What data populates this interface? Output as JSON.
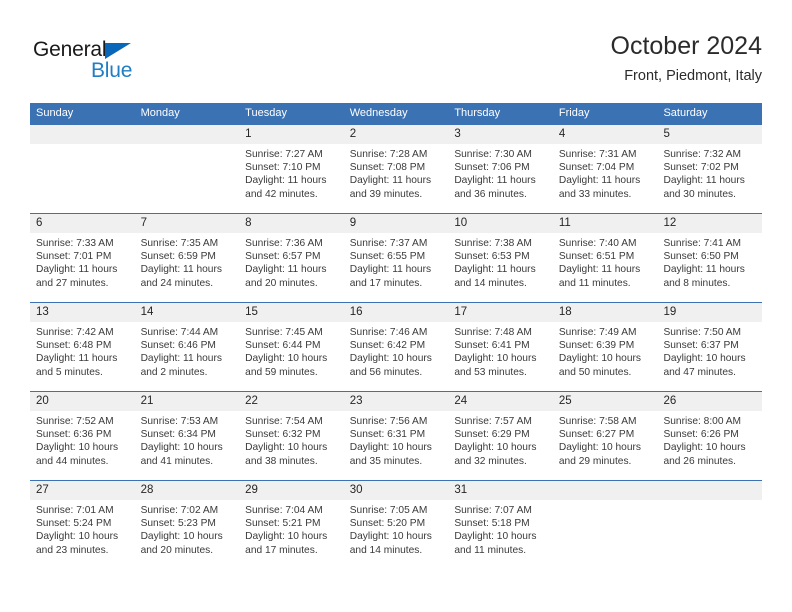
{
  "brand": {
    "name_top": "General",
    "name_bottom": "Blue",
    "color_dark": "#1a1a1a",
    "color_blue": "#1f7ec4",
    "triangle_color": "#0a66b8"
  },
  "header": {
    "title": "October 2024",
    "subtitle": "Front, Piedmont, Italy"
  },
  "theme": {
    "header_bar_color": "#3b72b4",
    "day_band_color": "#f0f0f0",
    "text_color": "#3a3a3a"
  },
  "weekdays": [
    "Sunday",
    "Monday",
    "Tuesday",
    "Wednesday",
    "Thursday",
    "Friday",
    "Saturday"
  ],
  "labels": {
    "sunrise_prefix": "Sunrise:",
    "sunset_prefix": "Sunset:",
    "daylight_prefix": "Daylight:"
  },
  "weeks": [
    [
      {
        "day": "",
        "sunrise": "",
        "sunset": "",
        "daylight_line1": "",
        "daylight_line2": ""
      },
      {
        "day": "",
        "sunrise": "",
        "sunset": "",
        "daylight_line1": "",
        "daylight_line2": ""
      },
      {
        "day": "1",
        "sunrise": "Sunrise: 7:27 AM",
        "sunset": "Sunset: 7:10 PM",
        "daylight_line1": "Daylight: 11 hours",
        "daylight_line2": "and 42 minutes."
      },
      {
        "day": "2",
        "sunrise": "Sunrise: 7:28 AM",
        "sunset": "Sunset: 7:08 PM",
        "daylight_line1": "Daylight: 11 hours",
        "daylight_line2": "and 39 minutes."
      },
      {
        "day": "3",
        "sunrise": "Sunrise: 7:30 AM",
        "sunset": "Sunset: 7:06 PM",
        "daylight_line1": "Daylight: 11 hours",
        "daylight_line2": "and 36 minutes."
      },
      {
        "day": "4",
        "sunrise": "Sunrise: 7:31 AM",
        "sunset": "Sunset: 7:04 PM",
        "daylight_line1": "Daylight: 11 hours",
        "daylight_line2": "and 33 minutes."
      },
      {
        "day": "5",
        "sunrise": "Sunrise: 7:32 AM",
        "sunset": "Sunset: 7:02 PM",
        "daylight_line1": "Daylight: 11 hours",
        "daylight_line2": "and 30 minutes."
      }
    ],
    [
      {
        "day": "6",
        "sunrise": "Sunrise: 7:33 AM",
        "sunset": "Sunset: 7:01 PM",
        "daylight_line1": "Daylight: 11 hours",
        "daylight_line2": "and 27 minutes."
      },
      {
        "day": "7",
        "sunrise": "Sunrise: 7:35 AM",
        "sunset": "Sunset: 6:59 PM",
        "daylight_line1": "Daylight: 11 hours",
        "daylight_line2": "and 24 minutes."
      },
      {
        "day": "8",
        "sunrise": "Sunrise: 7:36 AM",
        "sunset": "Sunset: 6:57 PM",
        "daylight_line1": "Daylight: 11 hours",
        "daylight_line2": "and 20 minutes."
      },
      {
        "day": "9",
        "sunrise": "Sunrise: 7:37 AM",
        "sunset": "Sunset: 6:55 PM",
        "daylight_line1": "Daylight: 11 hours",
        "daylight_line2": "and 17 minutes."
      },
      {
        "day": "10",
        "sunrise": "Sunrise: 7:38 AM",
        "sunset": "Sunset: 6:53 PM",
        "daylight_line1": "Daylight: 11 hours",
        "daylight_line2": "and 14 minutes."
      },
      {
        "day": "11",
        "sunrise": "Sunrise: 7:40 AM",
        "sunset": "Sunset: 6:51 PM",
        "daylight_line1": "Daylight: 11 hours",
        "daylight_line2": "and 11 minutes."
      },
      {
        "day": "12",
        "sunrise": "Sunrise: 7:41 AM",
        "sunset": "Sunset: 6:50 PM",
        "daylight_line1": "Daylight: 11 hours",
        "daylight_line2": "and 8 minutes."
      }
    ],
    [
      {
        "day": "13",
        "sunrise": "Sunrise: 7:42 AM",
        "sunset": "Sunset: 6:48 PM",
        "daylight_line1": "Daylight: 11 hours",
        "daylight_line2": "and 5 minutes."
      },
      {
        "day": "14",
        "sunrise": "Sunrise: 7:44 AM",
        "sunset": "Sunset: 6:46 PM",
        "daylight_line1": "Daylight: 11 hours",
        "daylight_line2": "and 2 minutes."
      },
      {
        "day": "15",
        "sunrise": "Sunrise: 7:45 AM",
        "sunset": "Sunset: 6:44 PM",
        "daylight_line1": "Daylight: 10 hours",
        "daylight_line2": "and 59 minutes."
      },
      {
        "day": "16",
        "sunrise": "Sunrise: 7:46 AM",
        "sunset": "Sunset: 6:42 PM",
        "daylight_line1": "Daylight: 10 hours",
        "daylight_line2": "and 56 minutes."
      },
      {
        "day": "17",
        "sunrise": "Sunrise: 7:48 AM",
        "sunset": "Sunset: 6:41 PM",
        "daylight_line1": "Daylight: 10 hours",
        "daylight_line2": "and 53 minutes."
      },
      {
        "day": "18",
        "sunrise": "Sunrise: 7:49 AM",
        "sunset": "Sunset: 6:39 PM",
        "daylight_line1": "Daylight: 10 hours",
        "daylight_line2": "and 50 minutes."
      },
      {
        "day": "19",
        "sunrise": "Sunrise: 7:50 AM",
        "sunset": "Sunset: 6:37 PM",
        "daylight_line1": "Daylight: 10 hours",
        "daylight_line2": "and 47 minutes."
      }
    ],
    [
      {
        "day": "20",
        "sunrise": "Sunrise: 7:52 AM",
        "sunset": "Sunset: 6:36 PM",
        "daylight_line1": "Daylight: 10 hours",
        "daylight_line2": "and 44 minutes."
      },
      {
        "day": "21",
        "sunrise": "Sunrise: 7:53 AM",
        "sunset": "Sunset: 6:34 PM",
        "daylight_line1": "Daylight: 10 hours",
        "daylight_line2": "and 41 minutes."
      },
      {
        "day": "22",
        "sunrise": "Sunrise: 7:54 AM",
        "sunset": "Sunset: 6:32 PM",
        "daylight_line1": "Daylight: 10 hours",
        "daylight_line2": "and 38 minutes."
      },
      {
        "day": "23",
        "sunrise": "Sunrise: 7:56 AM",
        "sunset": "Sunset: 6:31 PM",
        "daylight_line1": "Daylight: 10 hours",
        "daylight_line2": "and 35 minutes."
      },
      {
        "day": "24",
        "sunrise": "Sunrise: 7:57 AM",
        "sunset": "Sunset: 6:29 PM",
        "daylight_line1": "Daylight: 10 hours",
        "daylight_line2": "and 32 minutes."
      },
      {
        "day": "25",
        "sunrise": "Sunrise: 7:58 AM",
        "sunset": "Sunset: 6:27 PM",
        "daylight_line1": "Daylight: 10 hours",
        "daylight_line2": "and 29 minutes."
      },
      {
        "day": "26",
        "sunrise": "Sunrise: 8:00 AM",
        "sunset": "Sunset: 6:26 PM",
        "daylight_line1": "Daylight: 10 hours",
        "daylight_line2": "and 26 minutes."
      }
    ],
    [
      {
        "day": "27",
        "sunrise": "Sunrise: 7:01 AM",
        "sunset": "Sunset: 5:24 PM",
        "daylight_line1": "Daylight: 10 hours",
        "daylight_line2": "and 23 minutes."
      },
      {
        "day": "28",
        "sunrise": "Sunrise: 7:02 AM",
        "sunset": "Sunset: 5:23 PM",
        "daylight_line1": "Daylight: 10 hours",
        "daylight_line2": "and 20 minutes."
      },
      {
        "day": "29",
        "sunrise": "Sunrise: 7:04 AM",
        "sunset": "Sunset: 5:21 PM",
        "daylight_line1": "Daylight: 10 hours",
        "daylight_line2": "and 17 minutes."
      },
      {
        "day": "30",
        "sunrise": "Sunrise: 7:05 AM",
        "sunset": "Sunset: 5:20 PM",
        "daylight_line1": "Daylight: 10 hours",
        "daylight_line2": "and 14 minutes."
      },
      {
        "day": "31",
        "sunrise": "Sunrise: 7:07 AM",
        "sunset": "Sunset: 5:18 PM",
        "daylight_line1": "Daylight: 10 hours",
        "daylight_line2": "and 11 minutes."
      },
      {
        "day": "",
        "sunrise": "",
        "sunset": "",
        "daylight_line1": "",
        "daylight_line2": ""
      },
      {
        "day": "",
        "sunrise": "",
        "sunset": "",
        "daylight_line1": "",
        "daylight_line2": ""
      }
    ]
  ]
}
